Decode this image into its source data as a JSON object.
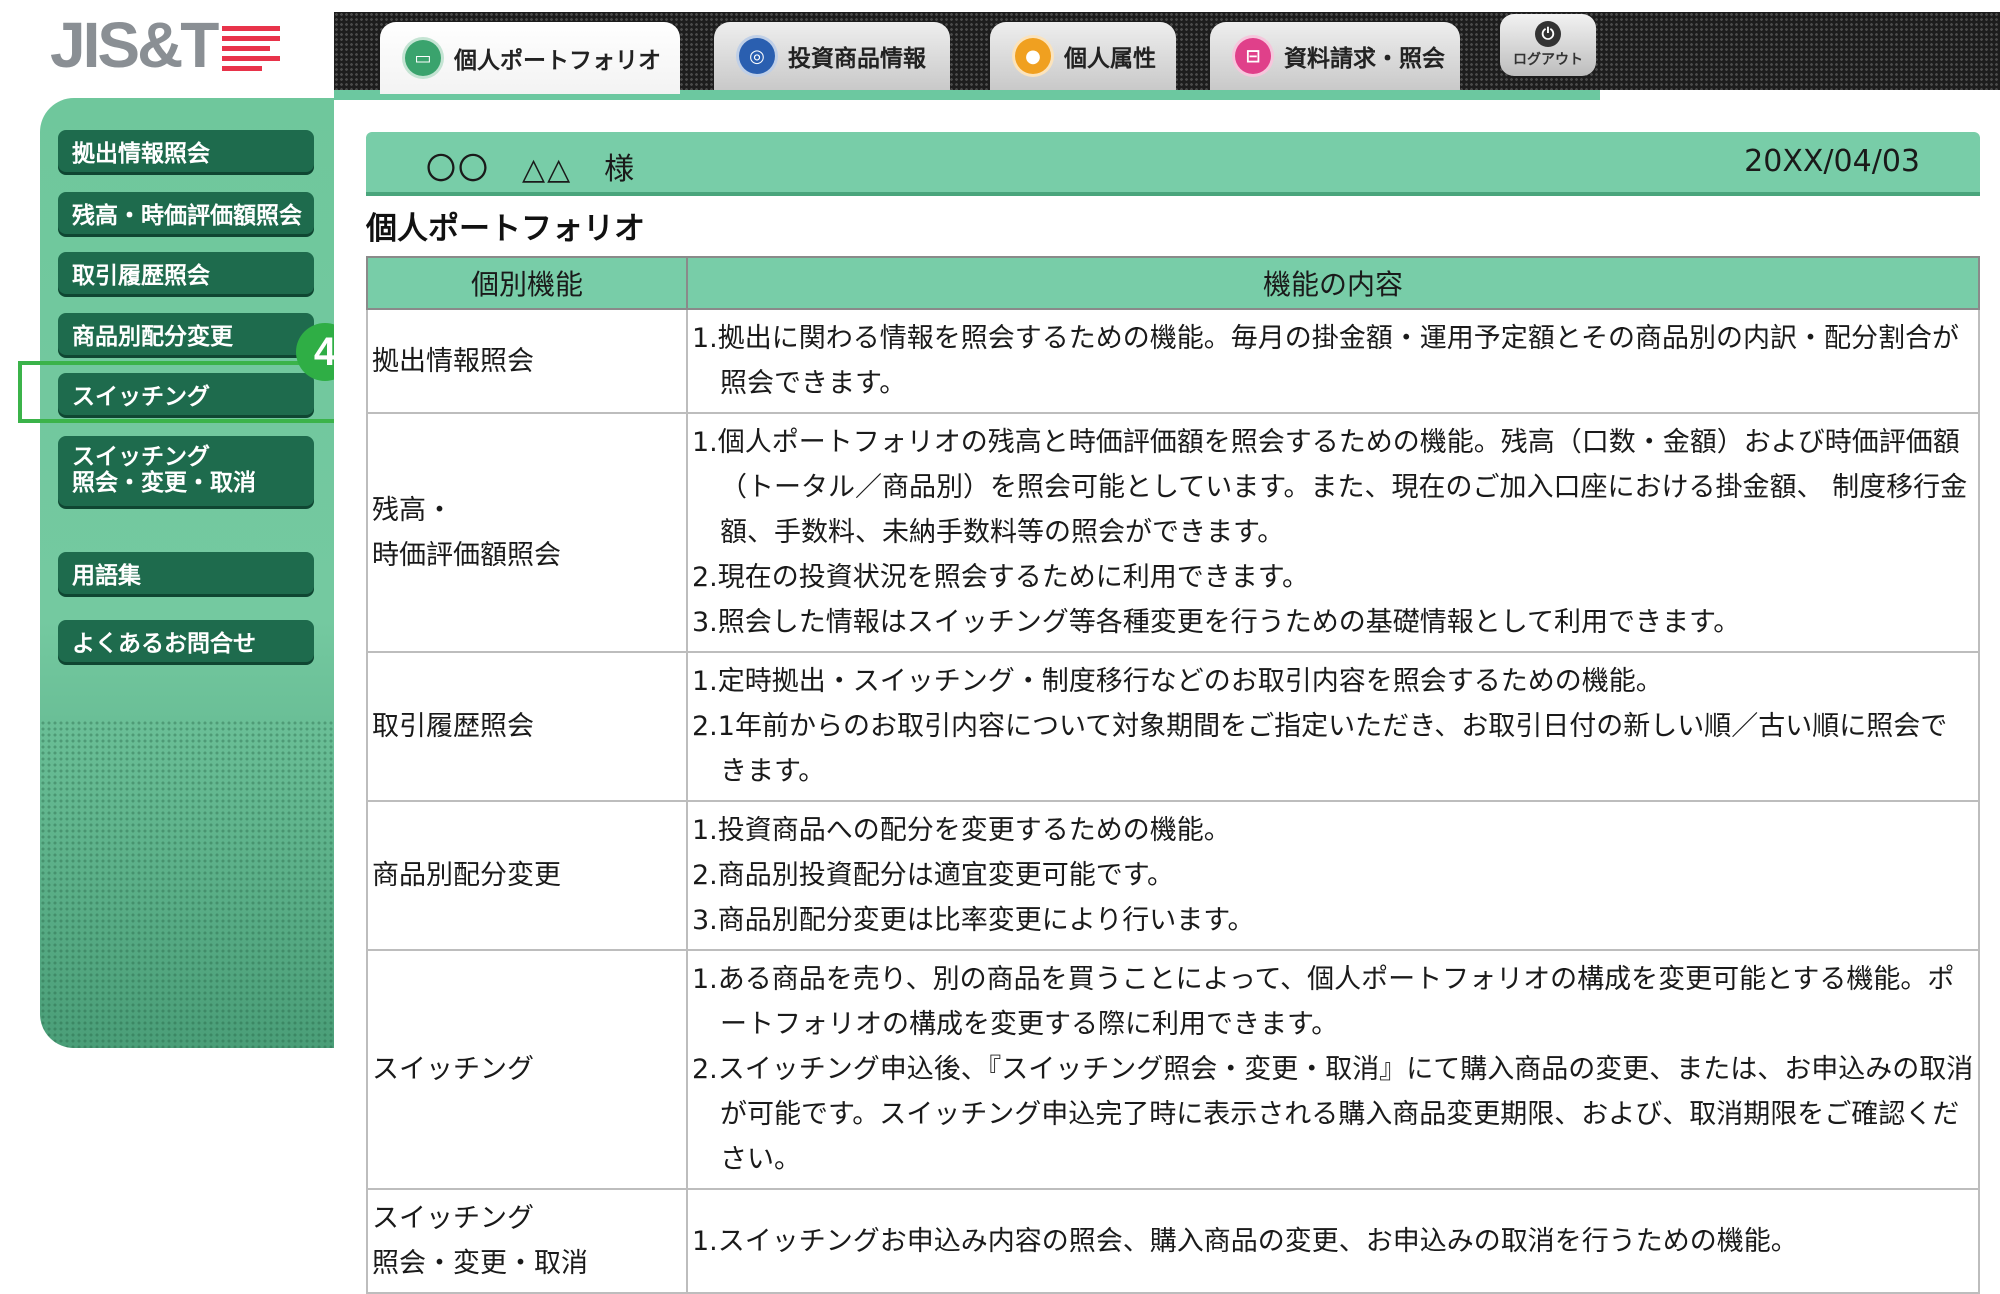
{
  "logo": {
    "text": "JIS&T"
  },
  "nav": {
    "tabs": [
      {
        "label": "個人ポートフォリオ",
        "icon": "portfolio-icon",
        "color": "#3aa36d",
        "glyph": "▭"
      },
      {
        "label": "投資商品情報",
        "icon": "investment-product-icon",
        "color": "#2a5fb0",
        "glyph": "◎"
      },
      {
        "label": "個人属性",
        "icon": "person-icon",
        "color": "#f0a020",
        "glyph": "●"
      },
      {
        "label": "資料請求・照会",
        "icon": "document-request-icon",
        "color": "#e0408a",
        "glyph": "⊟"
      }
    ],
    "logout_label": "ログアウト"
  },
  "sidebar": {
    "items": [
      {
        "label": "拠出情報照会"
      },
      {
        "label": "残高・時価評価額照会"
      },
      {
        "label": "取引履歴照会"
      },
      {
        "label": "商品別配分変更"
      },
      {
        "label": "スイッチング"
      },
      {
        "label": "スイッチング\n照会・変更・取消"
      },
      {
        "label": "用語集"
      },
      {
        "label": "よくあるお問合せ"
      }
    ],
    "step_badge": "4",
    "highlight_color": "#3bb34a"
  },
  "header": {
    "user_name": "〇〇　△△　様",
    "date": "20XX/04/03"
  },
  "page_title": "個人ポートフォリオ",
  "table": {
    "headers": [
      "個別機能",
      "機能の内容"
    ],
    "rows": [
      {
        "name": "拠出情報照会",
        "items": [
          "1.拠出に関わる情報を照会するための機能。毎月の掛金額・運用予定額とその商品別の内訳・配分割合が照会できます。"
        ]
      },
      {
        "name": "残高・\n時価評価額照会",
        "items": [
          "1.個人ポートフォリオの残高と時価評価額を照会するための機能。残高（口数・金額）および時価評価額（トータル／商品別）を照会可能としています。また、現在のご加入口座における掛金額、 制度移行金額、手数料、未納手数料等の照会ができます。",
          "2.現在の投資状況を照会するために利用できます。",
          "3.照会した情報はスイッチング等各種変更を行うための基礎情報として利用できます。"
        ]
      },
      {
        "name": "取引履歴照会",
        "items": [
          "1.定時拠出・スイッチング・制度移行などのお取引内容を照会するための機能。",
          "2.1年前からのお取引内容について対象期間をご指定いただき、お取引日付の新しい順／古い順に照会できます。"
        ]
      },
      {
        "name": "商品別配分変更",
        "items": [
          "1.投資商品への配分を変更するための機能。",
          "2.商品別投資配分は適宜変更可能です。",
          "3.商品別配分変更は比率変更により行います。"
        ]
      },
      {
        "name": "スイッチング",
        "items": [
          "1.ある商品を売り、別の商品を買うことによって、個人ポートフォリオの構成を変更可能とする機能。ポートフォリオの構成を変更する際に利用できます。",
          "2.スイッチング申込後、『スイッチング照会・変更・取消』にて購入商品の変更、または、お申込みの取消が可能です。スイッチング申込完了時に表示される購入商品変更期限、および、取消期限をご確認ください。"
        ]
      },
      {
        "name": "スイッチング\n照会・変更・取消",
        "items": [
          "1.スイッチングお申込み内容の照会、購入商品の変更、お申込みの取消を行うための機能。"
        ]
      }
    ]
  }
}
